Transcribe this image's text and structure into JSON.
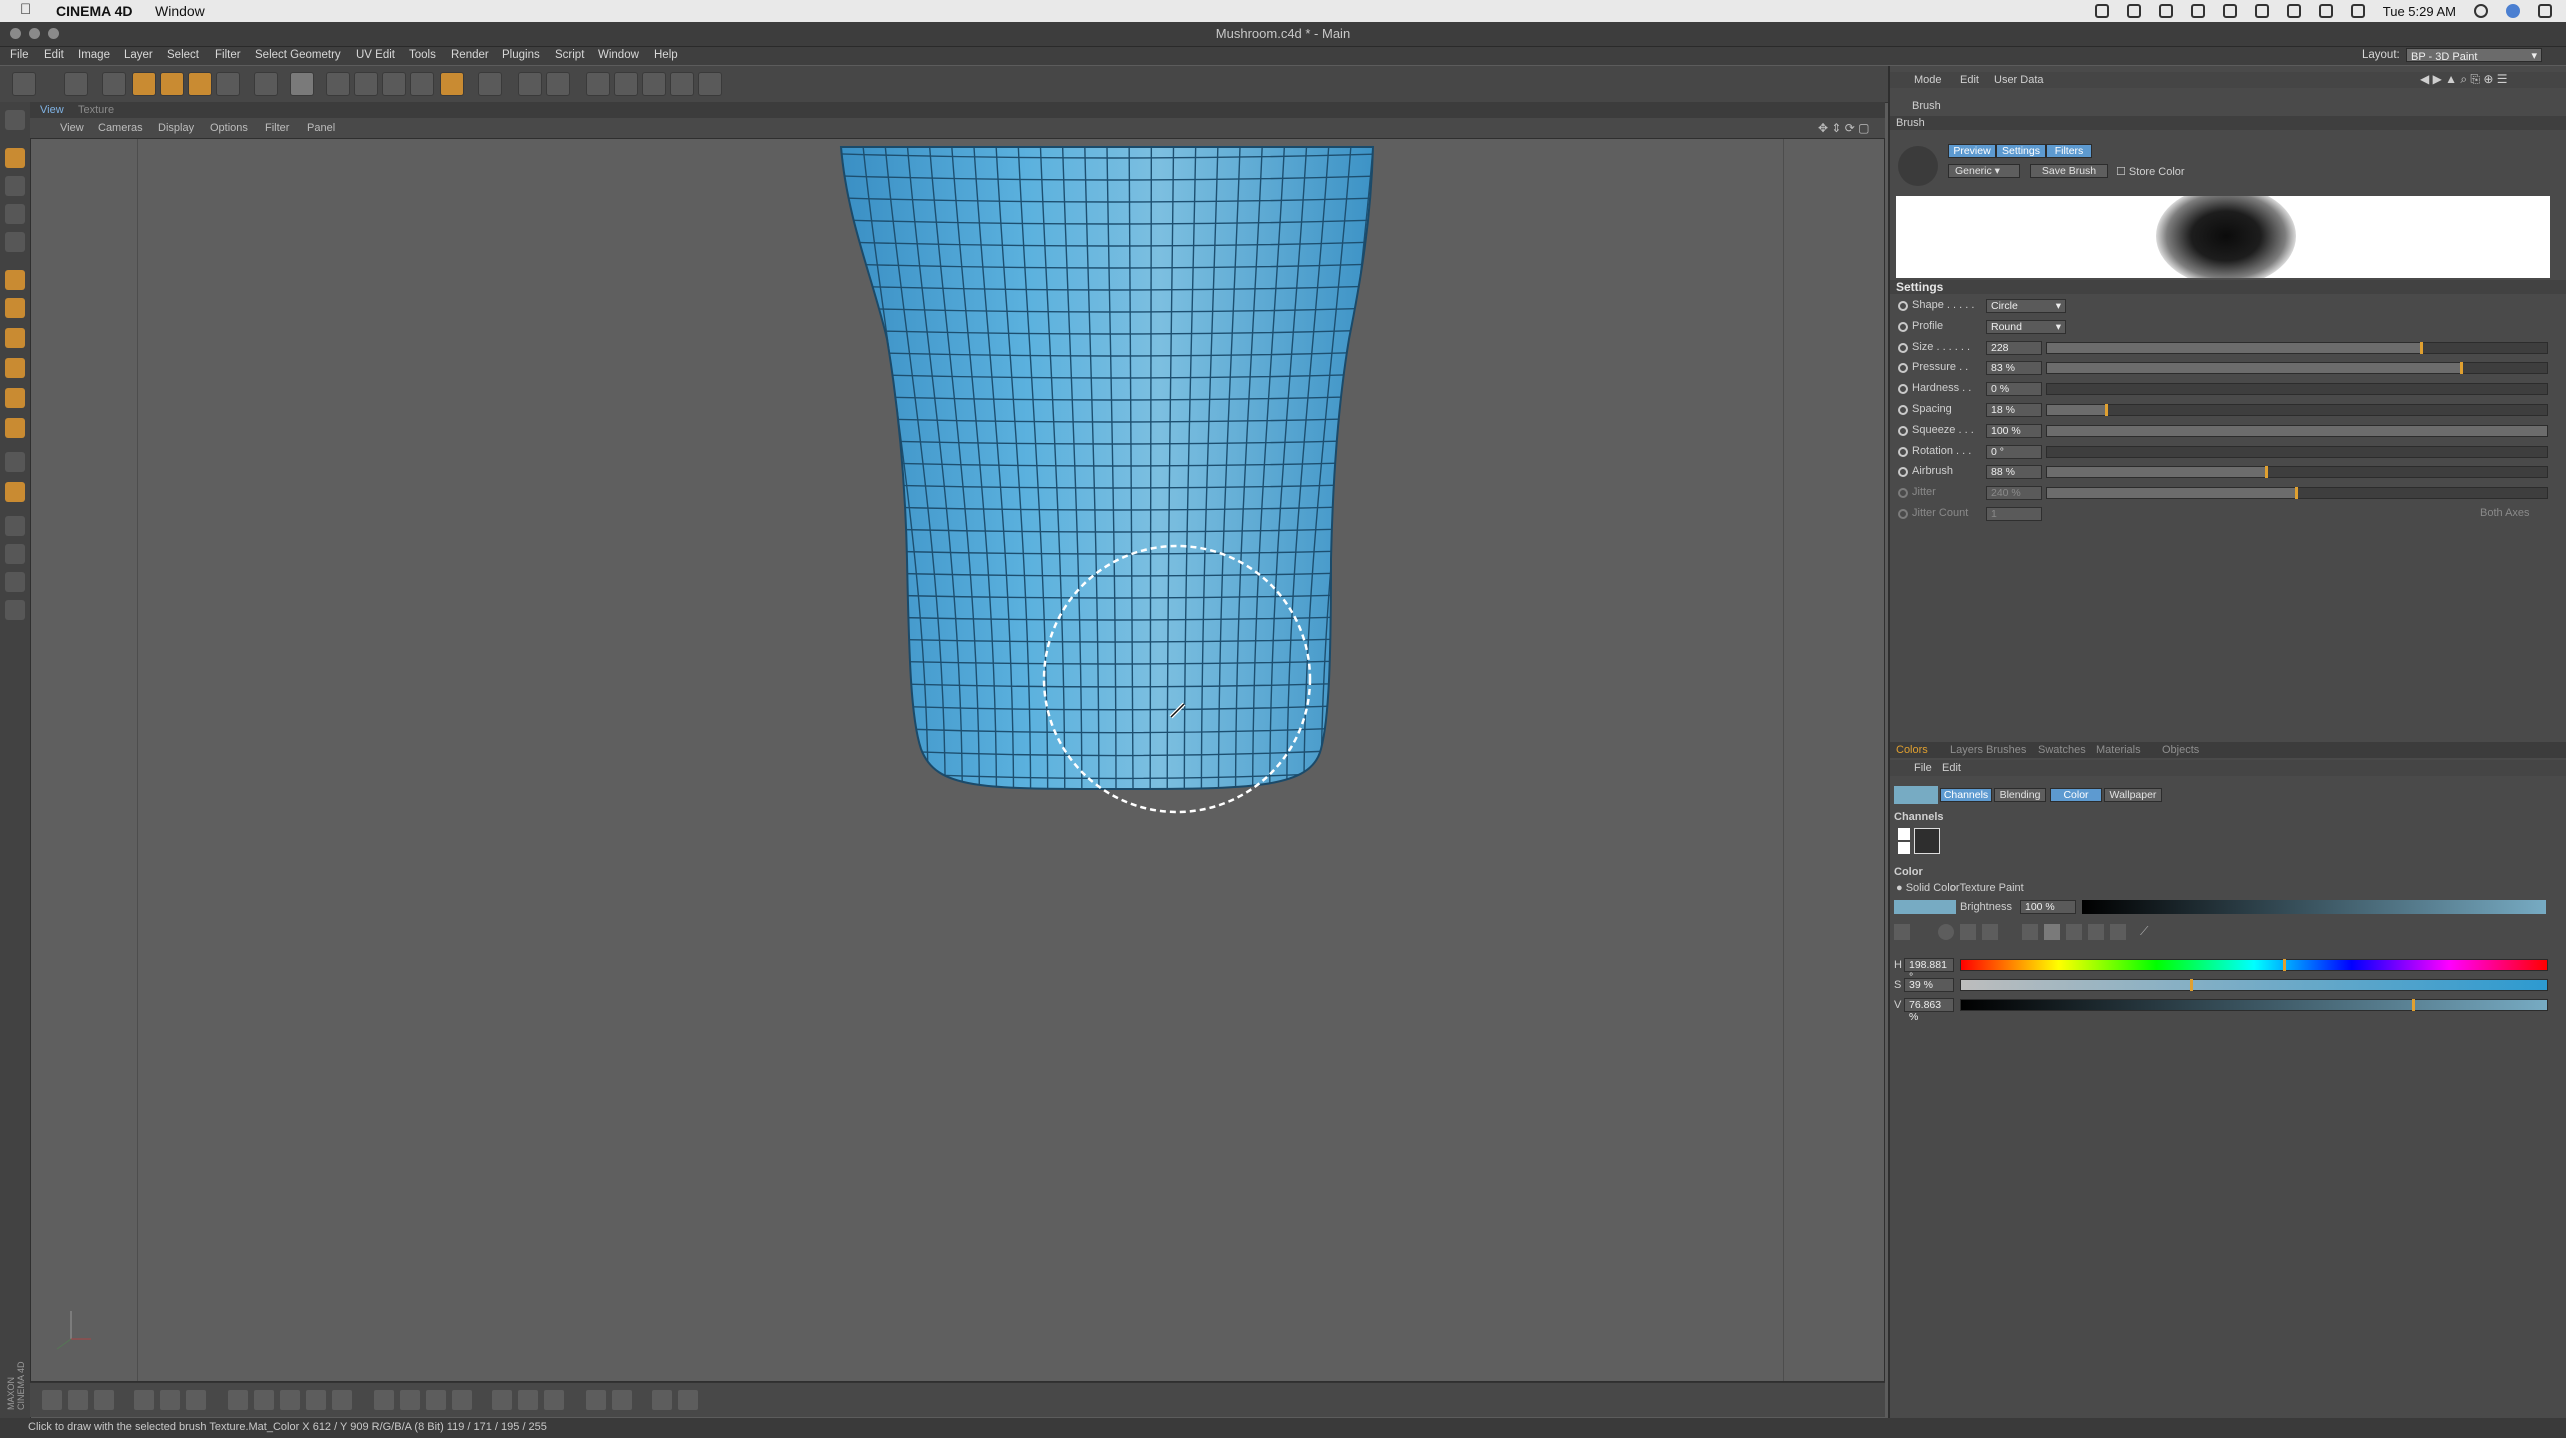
{
  "macbar": {
    "apple_icon": "apple-icon",
    "app_name": "CINEMA 4D",
    "menu_window": "Window",
    "clock": "Tue 5:29 AM"
  },
  "window": {
    "title": "Mushroom.c4d * - Main"
  },
  "appmenu": {
    "items": [
      "File",
      "Edit",
      "Image",
      "Layer",
      "Select",
      "Filter",
      "Select Geometry",
      "UV Edit",
      "Tools",
      "Render",
      "Plugins",
      "Script",
      "Window",
      "Help"
    ],
    "layout_label": "Layout:",
    "layout_value": "BP - 3D Paint"
  },
  "viewport": {
    "tabs": [
      "View",
      "Texture"
    ],
    "menu": [
      "View",
      "Cameras",
      "Display",
      "Options",
      "Filter",
      "Panel"
    ],
    "mesh_color": "#4aa6d6",
    "brush_circle_color": "#ffffff"
  },
  "status": {
    "text": "Click to draw with the selected brush  Texture.Mat_Color   X 612 / Y 909 R/G/B/A (8 Bit) 119 / 171 / 195 / 255"
  },
  "maxon": {
    "logo": "MAXON CINEMA 4D"
  },
  "attr": {
    "menu": [
      "Mode",
      "Edit",
      "User Data"
    ],
    "object_label": "Brush",
    "section_label": "Brush",
    "tabs": [
      "Preview",
      "Settings",
      "Filters"
    ],
    "preset": "Generic",
    "save_brush": "Save Brush",
    "store_color": "Store Color",
    "settings_title": "Settings",
    "params": [
      {
        "label": "Shape . . . . .",
        "value": "Circle",
        "type": "dropdown"
      },
      {
        "label": "Profile",
        "value": "Round",
        "type": "dropdown"
      },
      {
        "label": "Size . . . . . .",
        "value": "228",
        "pct": 0.75
      },
      {
        "label": "Pressure . .",
        "value": "83 %",
        "pct": 0.83
      },
      {
        "label": "Hardness . .",
        "value": "0 %",
        "pct": 0.0
      },
      {
        "label": "Spacing",
        "value": "18 %",
        "pct": 0.12
      },
      {
        "label": "Squeeze . . .",
        "value": "100 %",
        "pct": 1.0
      },
      {
        "label": "Rotation . . .",
        "value": "0 °",
        "pct": 0.0
      },
      {
        "label": "Airbrush",
        "value": "88 %",
        "pct": 0.44
      },
      {
        "label": "Jitter",
        "value": "240 %",
        "pct": 0.5
      },
      {
        "label": "Jitter Count",
        "value": "1",
        "pct": 0
      }
    ],
    "both_axes": "Both Axes"
  },
  "colors": {
    "tabs": [
      "Colors",
      "Layers",
      "Brushes",
      "Swatches",
      "Materials",
      "Objects"
    ],
    "menu": [
      "File",
      "Edit"
    ],
    "subtabs": [
      "Channels",
      "Blending",
      "Color",
      "Wallpaper"
    ],
    "channels_label": "Channels",
    "color_label": "Color",
    "solid_color": "Solid Color",
    "texture_paint": "Texture Paint",
    "brightness_label": "Brightness",
    "brightness_value": "100 %",
    "swatch": "#77abc3",
    "h_label": "H",
    "h_value": "198.881 °",
    "h_pct": 0.55,
    "s_label": "S",
    "s_value": "39 %",
    "s_pct": 0.39,
    "v_label": "V",
    "v_value": "76.863 %",
    "v_pct": 0.77
  }
}
